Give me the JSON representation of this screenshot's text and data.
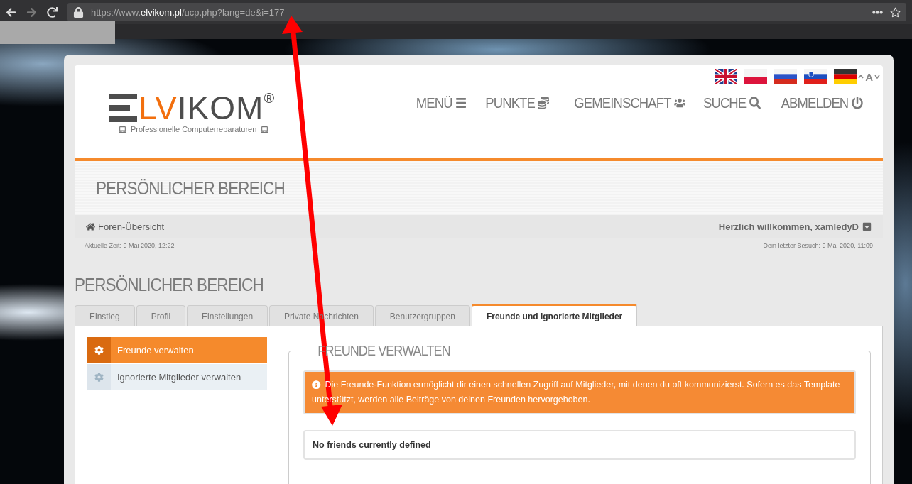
{
  "browser": {
    "url_prefix": "https://www.",
    "url_domain": "elvikom.pl",
    "url_path": "/ucp.php?lang=de&i=177"
  },
  "logo": {
    "accent": "LV",
    "rest": "IKOM",
    "mark": "®",
    "tagline": "Professionelle Computerreparaturen"
  },
  "flags": [
    {
      "kind": "gb"
    },
    {
      "kind": "pl"
    },
    {
      "kind": "ru"
    },
    {
      "kind": "si"
    },
    {
      "kind": "de"
    }
  ],
  "font_size_control": "A",
  "nav": [
    {
      "label": "MENÜ"
    },
    {
      "label": "PUNKTE"
    },
    {
      "label": "GEMEINSCHAFT"
    },
    {
      "label": "SUCHE"
    },
    {
      "label": "ABMELDEN"
    }
  ],
  "banner_title": "PERSÖNLICHER BEREICH",
  "breadcrumb": "Foren-Übersicht",
  "welcome": "Herzlich willkommen, xamledyD",
  "current_time": "Aktuelle Zeit: 9 Mai 2020, 12:22",
  "last_visit": "Dein letzter Besuch: 9 Mai 2020, 11:09",
  "page_title": "PERSÖNLICHER BEREICH",
  "tabs": [
    {
      "label": "Einstieg",
      "selected": false
    },
    {
      "label": "Profil",
      "selected": false
    },
    {
      "label": "Einstellungen",
      "selected": false
    },
    {
      "label": "Private Nachrichten",
      "selected": false
    },
    {
      "label": "Benutzergruppen",
      "selected": false
    },
    {
      "label": "Freunde und ignorierte Mitglieder",
      "selected": true
    }
  ],
  "sidebar": {
    "items": [
      {
        "label": "Freunde verwalten",
        "selected": true
      },
      {
        "label": "Ignorierte Mitglieder verwalten",
        "selected": false
      }
    ]
  },
  "section_title": "FREUNDE VERWALTEN",
  "info": "Die Freunde-Funktion ermöglicht dir einen schnellen Zugriff auf Mitglieder, mit denen du oft kommunizierst. Sofern es das Template unterstützt, werden alle Beiträge von deinen Freunden hervorgehoben.",
  "notice": "No friends currently defined"
}
